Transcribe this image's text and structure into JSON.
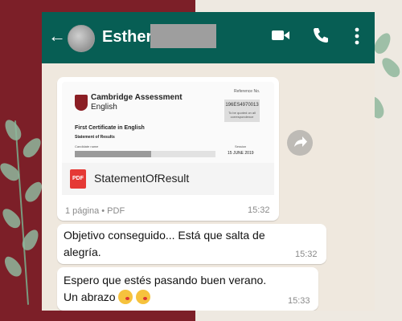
{
  "header": {
    "contact_name": "Esther",
    "back_icon": "arrow-left-icon",
    "video_icon": "video-camera-icon",
    "call_icon": "phone-icon",
    "menu_icon": "more-vertical-icon",
    "color": "#075e54"
  },
  "messages": [
    {
      "type": "document",
      "preview": {
        "org_line1": "Cambridge Assessment",
        "org_line2": "English",
        "reference_label": "Reference No.",
        "reference_value": "196ES4970013",
        "reference_note": "To be quoted on all correspondence",
        "title": "First Certificate in English",
        "subtitle": "Statement of Results",
        "candidate_label": "Candidate name",
        "session_label": "Session",
        "session_value": "15 JUNE 2019"
      },
      "file_name": "StatementOfResult",
      "file_meta": "1 página • PDF",
      "time": "15:32"
    },
    {
      "type": "text",
      "line1": "Objetivo conseguido... Está que salta de",
      "line2": "alegría.",
      "time": "15:32"
    },
    {
      "type": "text",
      "line1": "Espero que estés pasando buen verano.",
      "line2": "Un abrazo",
      "emoji": "face-blowing-kiss",
      "time": "15:33"
    }
  ],
  "colors": {
    "background_left": "#7c1f28",
    "background_right": "#eee9e1",
    "chat_background": "#efe8de",
    "bubble": "#ffffff",
    "pdf_red": "#e53935"
  }
}
